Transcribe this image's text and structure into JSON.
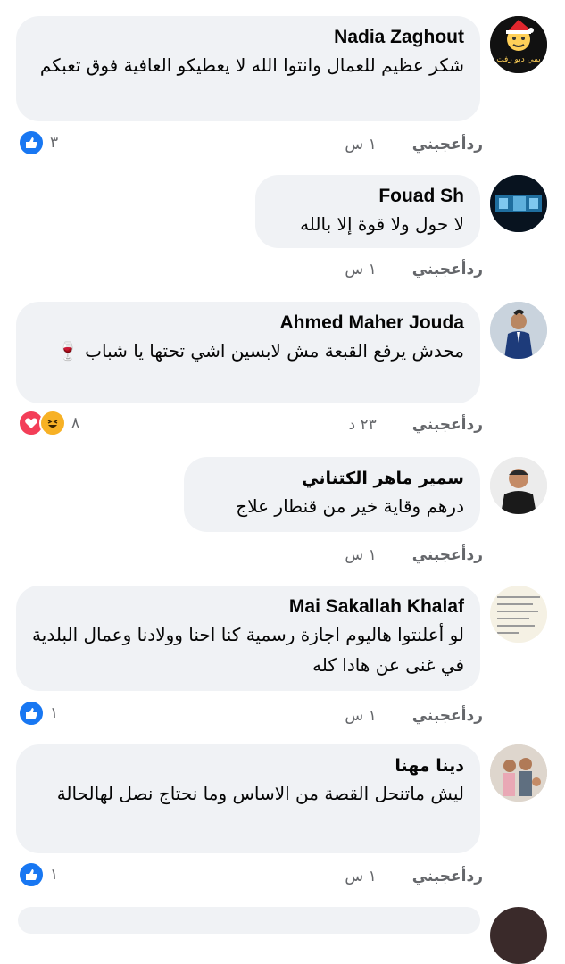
{
  "comments": [
    {
      "author": "Nadia Zaghout",
      "text": "شكر عظيم للعمال وانتوا الله لا يعطيكو العافية فوق تعبكم",
      "time": "١ س",
      "like_label": "أعجبني",
      "reply_label": "رد",
      "reactions": [
        "like"
      ],
      "reaction_count": "٣",
      "avatar_text": "يمي ديو زفت"
    },
    {
      "author": "Fouad Sh",
      "text": "لا حول ولا قوة إلا بالله",
      "time": "١ س",
      "like_label": "أعجبني",
      "reply_label": "رد",
      "reactions": [],
      "reaction_count": ""
    },
    {
      "author": "Ahmed Maher Jouda",
      "text": "محدش يرفع القبعة مش لابسين اشي تحتها يا شباب 🍷",
      "time": "٢٣ د",
      "like_label": "أعجبني",
      "reply_label": "رد",
      "reactions": [
        "love",
        "haha"
      ],
      "reaction_count": "٨"
    },
    {
      "author": "سمير ماهر الكتناني",
      "text": "درهم وقاية خير من قنطار علاج",
      "time": "١ س",
      "like_label": "أعجبني",
      "reply_label": "رد",
      "reactions": [],
      "reaction_count": ""
    },
    {
      "author": "Mai Sakallah Khalaf",
      "text": "لو أعلنتوا هاليوم اجازة رسمية كنا احنا وولادنا وعمال البلدية في غنى عن هادا كله",
      "time": "١ س",
      "like_label": "أعجبني",
      "reply_label": "رد",
      "reactions": [
        "like"
      ],
      "reaction_count": "١"
    },
    {
      "author": "دينا مهنا",
      "text": "ليش ماتنحل القصة من الاساس وما نحتاج نصل لهالحالة",
      "time": "١ س",
      "like_label": "أعجبني",
      "reply_label": "رد",
      "reactions": [
        "like"
      ],
      "reaction_count": "١"
    }
  ],
  "colors": {
    "bubble": "#f0f2f5",
    "meta": "#65676b",
    "like_blue": "#1877f2",
    "love_red": "#f33e58",
    "haha_yellow": "#f7b125"
  }
}
